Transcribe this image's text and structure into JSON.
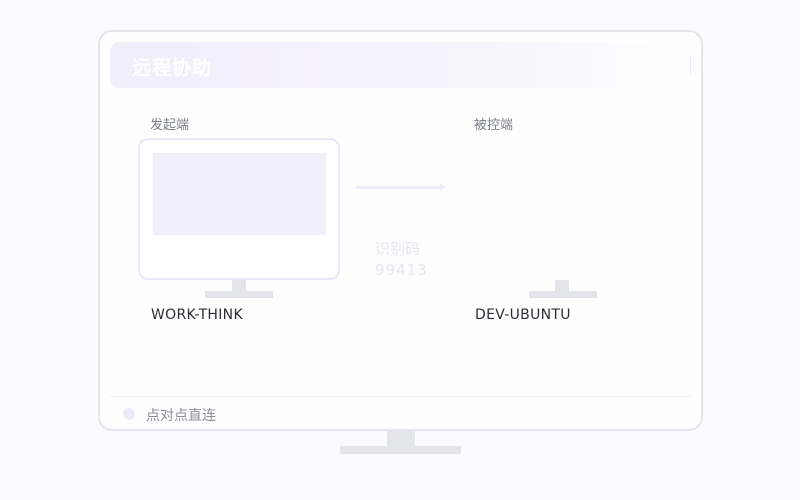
{
  "window": {
    "title": "远程协助"
  },
  "initiator": {
    "label": "发起端",
    "host": "WORK-THINK"
  },
  "controlled": {
    "label": "被控端",
    "host": "DEV-UBUNTU"
  },
  "connection": {
    "code_label": "识别码",
    "code": "99413"
  },
  "footer": {
    "status": "点对点直连"
  },
  "colors": {
    "accent": "#f1eefc",
    "border": "#e4e5ea",
    "stand": "#e3e5ea"
  }
}
